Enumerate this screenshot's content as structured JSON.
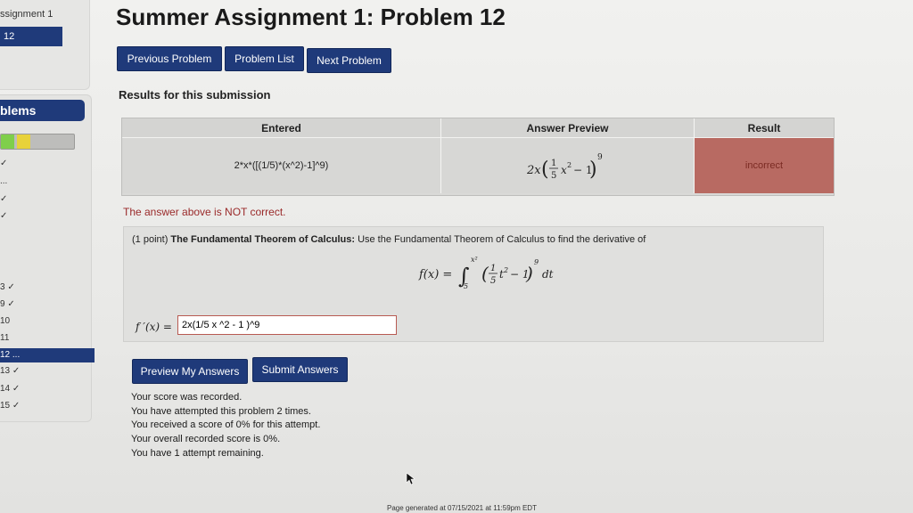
{
  "sidebar": {
    "set_title": "ssignment 1",
    "current_problem": "12",
    "problems_header": "blems",
    "items": [
      {
        "label": "✓"
      },
      {
        "label": "..."
      },
      {
        "label": "✓"
      },
      {
        "label": "✓"
      },
      {
        "label": "3 ✓"
      },
      {
        "label": "9 ✓"
      },
      {
        "label": "10"
      },
      {
        "label": "11"
      },
      {
        "label": "12 ..."
      },
      {
        "label": "13 ✓"
      },
      {
        "label": "14 ✓"
      },
      {
        "label": "15 ✓"
      }
    ]
  },
  "header": {
    "title": "Summer Assignment 1: Problem 12"
  },
  "nav": {
    "previous": "Previous Problem",
    "list": "Problem List",
    "next": "Next Problem"
  },
  "results": {
    "title": "Results for this submission",
    "columns": [
      "Entered",
      "Answer Preview",
      "Result"
    ],
    "entered": "2*x*([(1/5)*(x^2)-1]^9)",
    "result": "incorrect",
    "not_correct_msg": "The answer above is NOT correct."
  },
  "problem": {
    "points": "(1 point)",
    "heading": "The Fundamental Theorem of Calculus:",
    "text": "Use the Fundamental Theorem of Calculus to find the derivative of",
    "answer_label": "f ′(x) =",
    "answer_value": "2x(1/5 x ^2 - 1 )^9"
  },
  "actions": {
    "preview": "Preview My Answers",
    "submit": "Submit Answers"
  },
  "status": [
    "Your score was recorded.",
    "You have attempted this problem 2 times.",
    "You received a score of 0% for this attempt.",
    "Your overall recorded score is 0%.",
    "You have 1 attempt remaining."
  ],
  "footer": "Page generated at 07/15/2021 at 11:59pm EDT",
  "colors": {
    "nav_blue": "#1f3a7a",
    "incorrect_red": "#b86a62"
  }
}
